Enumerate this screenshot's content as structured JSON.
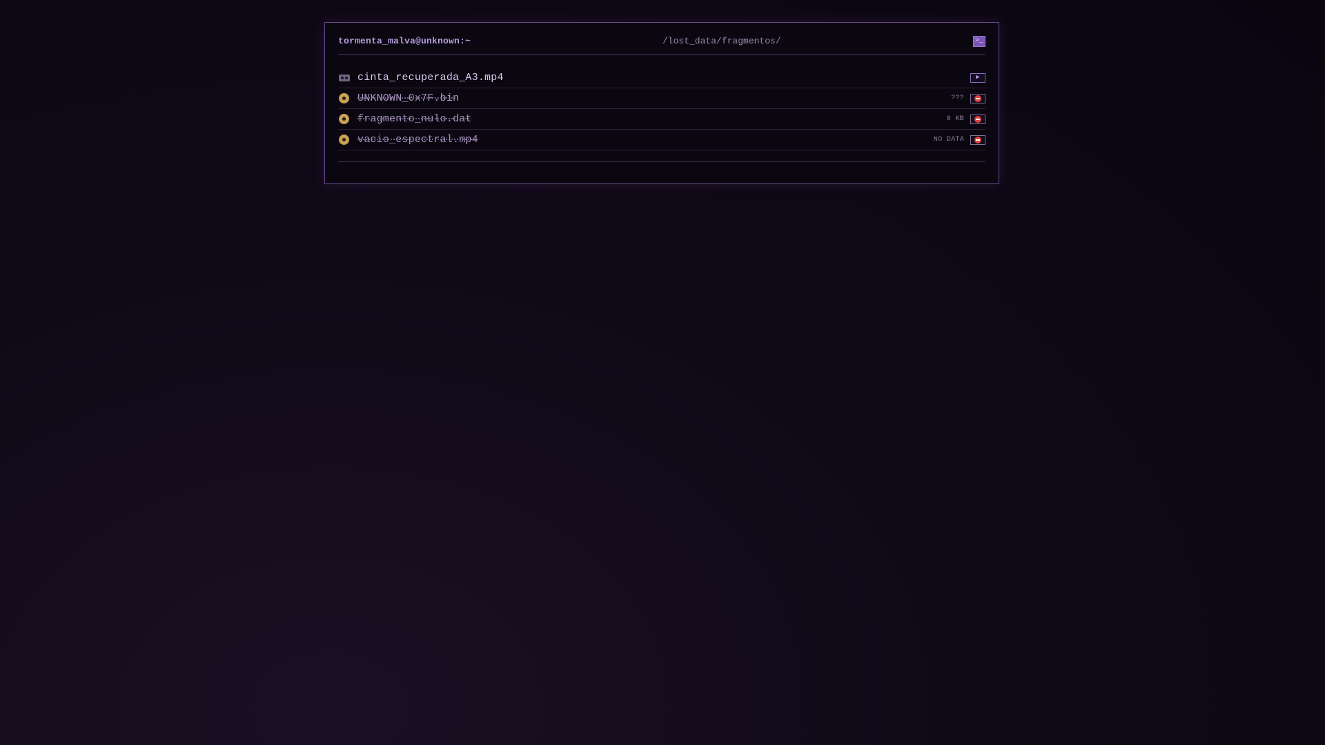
{
  "terminal": {
    "user_host": "tormenta_malva@unknown:~",
    "path": "/lost_data/fragmentos/",
    "terminal_button_glyph": ">_"
  },
  "files": [
    {
      "name": "cinta_recuperada_A3.mp4",
      "icon": "videocassette-icon",
      "status": "ok",
      "size": "",
      "action": "play"
    },
    {
      "name": "UNKNOWN_0x7F.bin",
      "icon": "disc-icon",
      "status": "corrupted",
      "size": "???",
      "action": "blocked"
    },
    {
      "name": "fragmento_nulo.dat",
      "icon": "disc-icon",
      "status": "corrupted",
      "size": "0 KB",
      "action": "blocked"
    },
    {
      "name": "vacio_espectral.mp4",
      "icon": "disc-icon",
      "status": "corrupted",
      "size": "NO DATA",
      "action": "blocked"
    }
  ],
  "colors": {
    "accent": "#7c55b8",
    "border": "#6a4a94",
    "blocked": "#e0443c",
    "disc": "#c9a057"
  },
  "play_glyph": "▶"
}
